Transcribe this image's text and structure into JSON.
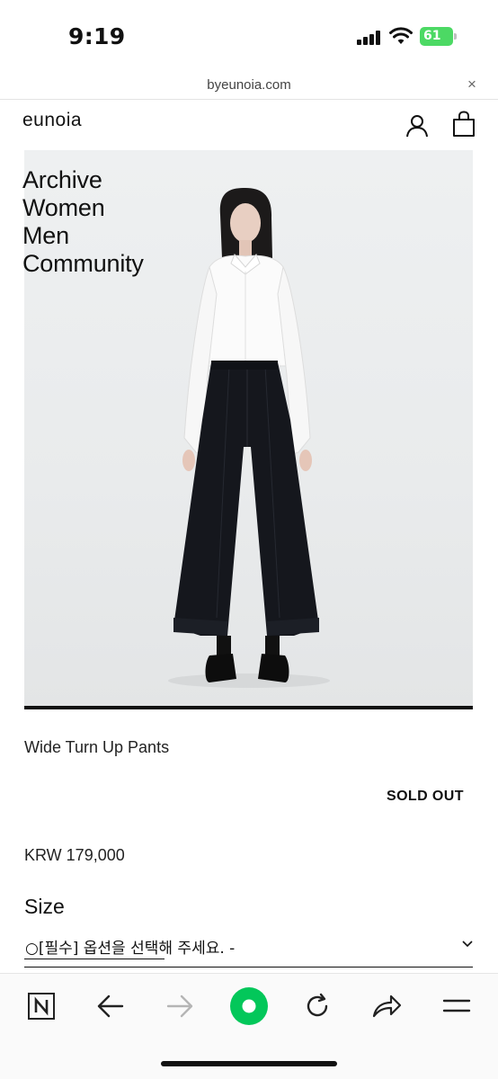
{
  "status_bar": {
    "time": "9:19",
    "battery": "61"
  },
  "browser": {
    "url": "byeunoia.com",
    "close_icon": "×"
  },
  "site": {
    "logo": "eunoia",
    "nav": [
      "Archive",
      "Women",
      "Men",
      "Community"
    ]
  },
  "product": {
    "name": "Wide Turn Up Pants",
    "status": "SOLD OUT",
    "price": "KRW 179,000",
    "size_label": "Size",
    "option_placeholder": "○[필수] 옵션을 선택해 주세요. -"
  },
  "toolbar": {
    "icons": [
      "naver-n-icon",
      "back-arrow-icon",
      "forward-arrow-icon",
      "green-circle-icon",
      "reload-icon",
      "share-icon",
      "menu-icon"
    ],
    "accent_color": "#03c75a"
  }
}
